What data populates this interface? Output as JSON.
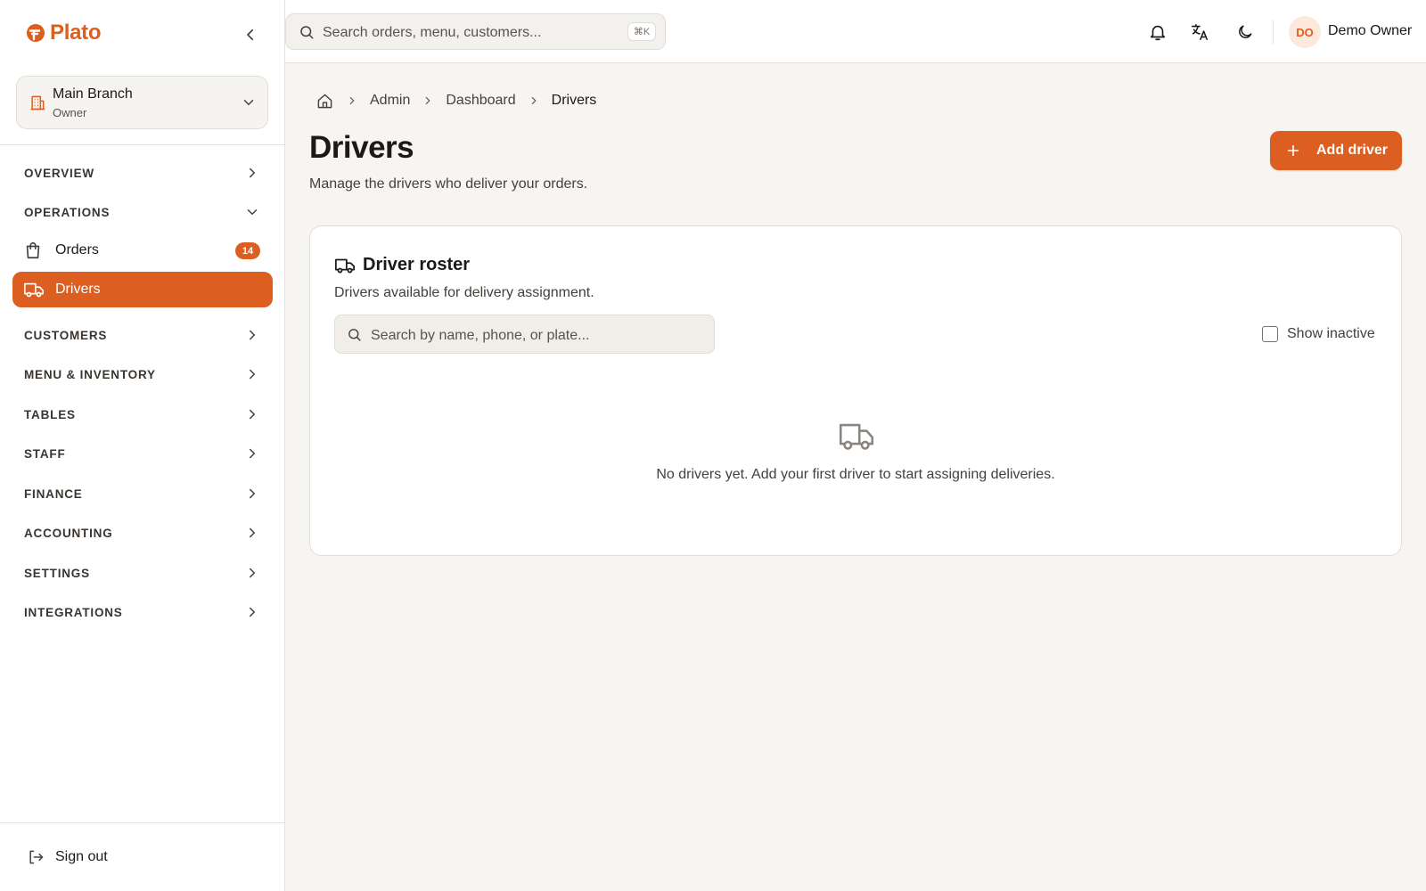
{
  "app": {
    "name": "Plato"
  },
  "colors": {
    "accent": "#dd5e21",
    "accent_soft": "#fde8dc",
    "background": "#f7f5f2"
  },
  "branch": {
    "name": "Main Branch",
    "role": "Owner"
  },
  "sidebar": {
    "sections": [
      {
        "label": "OVERVIEW",
        "expanded": false
      },
      {
        "label": "OPERATIONS",
        "expanded": true
      },
      {
        "label": "CUSTOMERS",
        "expanded": false
      },
      {
        "label": "MENU & INVENTORY",
        "expanded": false
      },
      {
        "label": "TABLES",
        "expanded": false
      },
      {
        "label": "STAFF",
        "expanded": false
      },
      {
        "label": "FINANCE",
        "expanded": false
      },
      {
        "label": "ACCOUNTING",
        "expanded": false
      },
      {
        "label": "SETTINGS",
        "expanded": false
      },
      {
        "label": "INTEGRATIONS",
        "expanded": false
      }
    ],
    "operations_items": [
      {
        "label": "Orders",
        "icon": "shopping-bag-icon",
        "badge": "14",
        "active": false
      },
      {
        "label": "Drivers",
        "icon": "truck-icon",
        "active": true
      }
    ],
    "sign_out": "Sign out"
  },
  "header": {
    "search_placeholder": "Search orders, menu, customers...",
    "shortcut": "⌘K",
    "icons": [
      "bell-icon",
      "translate-icon",
      "moon-icon"
    ],
    "user": {
      "initials": "DO",
      "name": "Demo Owner"
    }
  },
  "breadcrumb": [
    "Admin",
    "Dashboard",
    "Drivers"
  ],
  "page": {
    "title": "Drivers",
    "subtitle": "Manage the drivers who deliver your orders.",
    "add_button": "Add driver"
  },
  "roster": {
    "title": "Driver roster",
    "subtitle": "Drivers available for delivery assignment.",
    "search_placeholder": "Search by name, phone, or plate...",
    "show_inactive_label": "Show inactive",
    "show_inactive_checked": false,
    "empty_message": "No drivers yet. Add your first driver to start assigning deliveries."
  }
}
